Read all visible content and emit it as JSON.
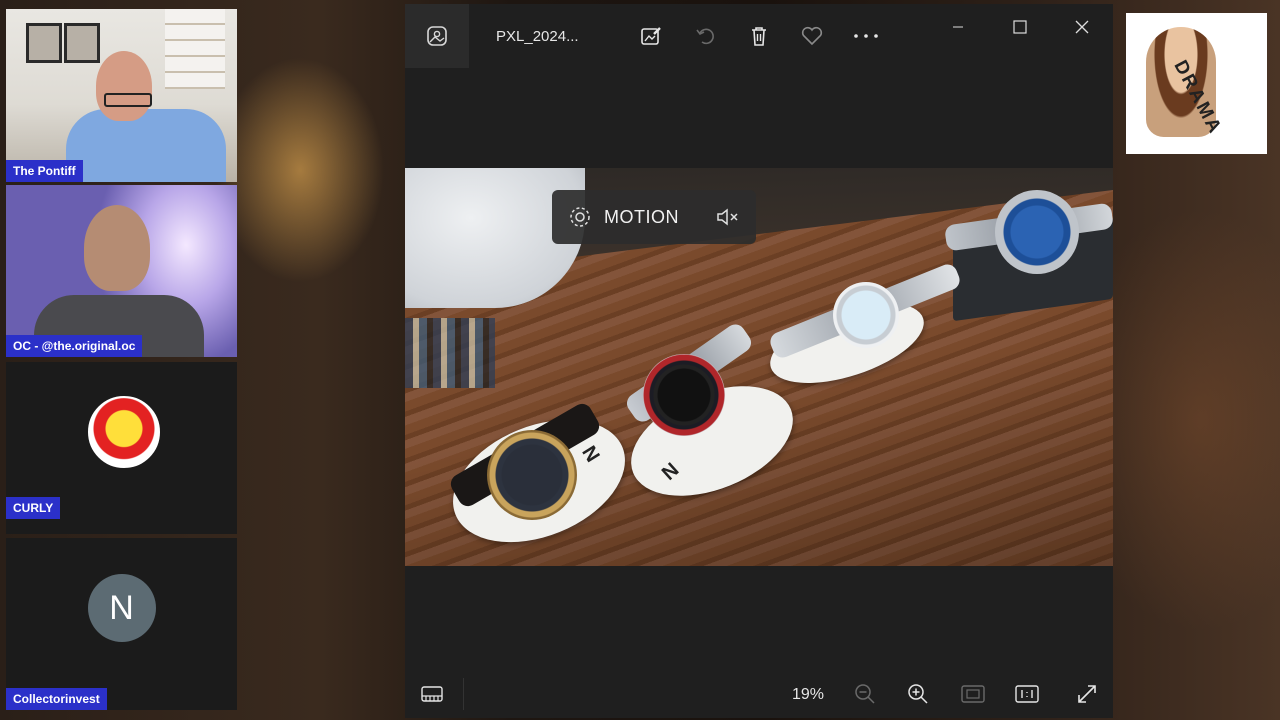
{
  "participants": [
    {
      "name": "The Pontiff"
    },
    {
      "name": "OC - @the.original.oc"
    },
    {
      "name": "CURLY"
    },
    {
      "name": "Collectorinvest",
      "avatar_letter": "N"
    }
  ],
  "viewer": {
    "file_title": "PXL_2024...",
    "motion_label": "MOTION",
    "zoom_level": "19%",
    "toolbar_icons": [
      "photos-app-icon",
      "edit-image-icon",
      "rotate-icon",
      "delete-icon",
      "favorite-icon",
      "more-options-icon"
    ],
    "window_controls": [
      "minimize",
      "maximize",
      "close"
    ],
    "bottom_icons": [
      "filmstrip-icon",
      "zoom-out-icon",
      "zoom-in-icon",
      "fit-to-window-icon",
      "actual-size-icon",
      "fullscreen-icon"
    ]
  },
  "sticker": {
    "text": "DRAMA"
  },
  "colors": {
    "name_tag": "#2b30c9",
    "viewer_bg": "#1f1f1f",
    "toolbar_icon": "#e6e6e6"
  }
}
